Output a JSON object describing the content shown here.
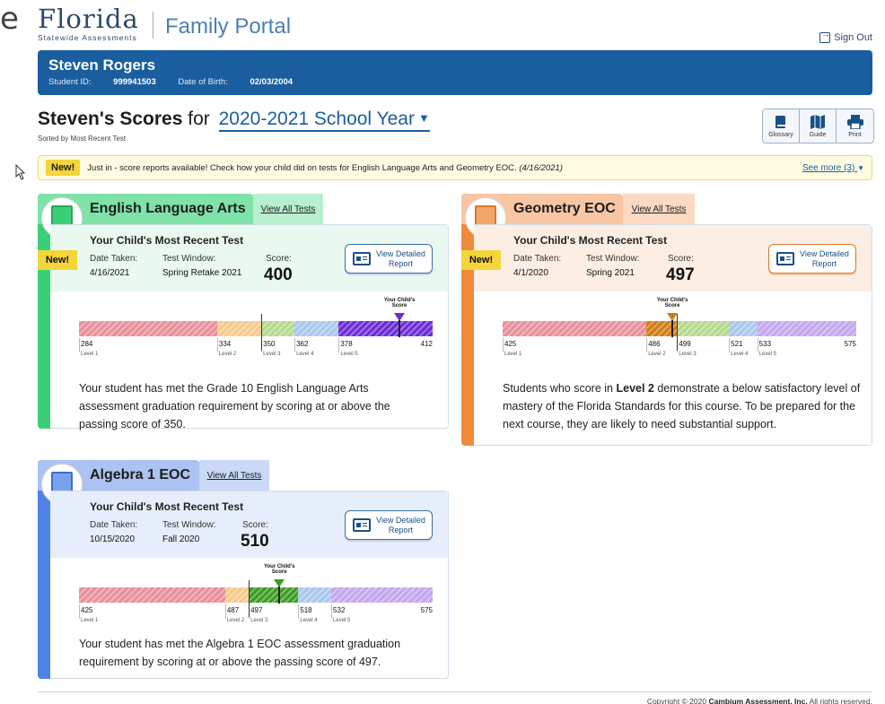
{
  "header": {
    "partial_letter": "e",
    "logo_word": "Florida",
    "logo_sub": "Statewide Assessments",
    "portal_title": "Family Portal",
    "signout_label": "Sign Out"
  },
  "student": {
    "name": "Steven Rogers",
    "id_label": "Student ID:",
    "id_value": "999941503",
    "dob_label": "Date of Birth:",
    "dob_value": "02/03/2004"
  },
  "scores_header": {
    "title_bold": "Steven's Scores",
    "title_for": "for",
    "year": "2020-2021 School Year",
    "sorted_by": "Sorted by Most Recent Test"
  },
  "tools": [
    {
      "label": "Glossary",
      "icon": "book-icon"
    },
    {
      "label": "Guide",
      "icon": "map-icon"
    },
    {
      "label": "Print",
      "icon": "printer-icon"
    }
  ],
  "notice": {
    "badge": "New!",
    "text": "Just in - score reports available! Check how your child did on tests for English Language Arts and Geometry EOC.",
    "date": "(4/16/2021)",
    "see_more": "See more (3)"
  },
  "common": {
    "recent_title": "Your Child's Most Recent Test",
    "date_label": "Date Taken:",
    "window_label": "Test Window:",
    "score_label": "Score:",
    "view_all": "View All Tests",
    "report_line1": "View Detailed",
    "report_line2": "Report",
    "new_flag": "New!",
    "marker_line1": "Your Child's",
    "marker_line2": "Score",
    "level_prefix": "Level"
  },
  "cards": {
    "ela": {
      "title": "English Language Arts",
      "date": "4/16/2021",
      "window": "Spring Retake 2021",
      "score": "400",
      "score_num": 400,
      "cuts": [
        284,
        334,
        350,
        362,
        378,
        412
      ],
      "cut_labels": [
        "284",
        "334",
        "350",
        "362",
        "378",
        "412"
      ],
      "level": 5,
      "desc": "Your student has met the Grade 10 English Language Arts assessment graduation requirement by scoring at or above the passing score of 350."
    },
    "geo": {
      "title": "Geometry EOC",
      "date": "4/1/2020",
      "window": "Spring 2021",
      "score": "497",
      "score_num": 497,
      "cuts": [
        425,
        486,
        499,
        521,
        533,
        575
      ],
      "cut_labels": [
        "425",
        "486",
        "499",
        "521",
        "533",
        "575"
      ],
      "level": 2,
      "desc_pre": "Students who score in",
      "desc_level": "Level 2",
      "desc_post": "demonstrate a below satisfactory level of mastery of the Florida Standards for this course. To be prepared for the next course, they are likely to need substantial support."
    },
    "alg": {
      "title": "Algebra 1 EOC",
      "date": "10/15/2020",
      "window": "Fall 2020",
      "score": "510",
      "score_num": 510,
      "cuts": [
        425,
        487,
        497,
        518,
        532,
        575
      ],
      "cut_labels": [
        "425",
        "487",
        "497",
        "518",
        "532",
        "575"
      ],
      "level": 3,
      "desc": "Your student has met the Algebra 1 EOC assessment graduation requirement by scoring at or above the passing score of 497."
    }
  },
  "colors": {
    "level1": "#e88f9a",
    "level2": "#f5c98a",
    "level3": "#b6d88c",
    "level4": "#a9c7ec",
    "level5": "#c4a6ee",
    "ela_accent": "#3bcf7a",
    "ela_tab": "#7ee2a9",
    "geo_accent": "#f08a3a",
    "geo_tab": "#f9c6a4",
    "alg_accent": "#4f84e6",
    "alg_tab": "#aac3f2",
    "level5_dark": "#6b2bd6",
    "level2_dark": "#d07b12",
    "level3_dark": "#3b9c22"
  },
  "footer": {
    "copyright_pre": "Copyright © 2020",
    "company": "Cambium Assessment, Inc.",
    "copyright_post": "All rights reserved."
  }
}
